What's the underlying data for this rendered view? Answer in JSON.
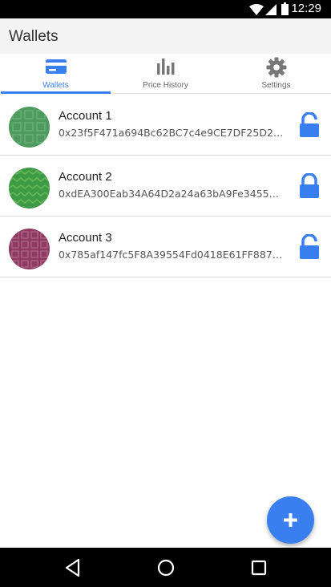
{
  "status_bar": {
    "time": "12:29",
    "icons": [
      "wifi-icon",
      "signal-icon",
      "battery-icon"
    ]
  },
  "app_bar": {
    "title": "Wallets"
  },
  "tabs": [
    {
      "label": "Wallets",
      "icon": "wallet-card-icon",
      "active": true
    },
    {
      "label": "Price History",
      "icon": "bar-chart-icon",
      "active": false
    },
    {
      "label": "Settings",
      "icon": "gear-icon",
      "active": false
    }
  ],
  "accounts": [
    {
      "name": "Account 1",
      "address": "0x23f5F471a694Bc62BC7c4e9CE7DF25D281...",
      "avatar_color": "#4e9a5f",
      "lock": "unlocked"
    },
    {
      "name": "Account 2",
      "address": "0xdEA300Eab34A64D2a24a63bA9Fe345583...",
      "avatar_color": "#3e9a45",
      "lock": "locked"
    },
    {
      "name": "Account 3",
      "address": "0x785af147fc5F8A39554Fd0418E61FF88799...",
      "avatar_color": "#8e3a62",
      "lock": "unlocked"
    }
  ],
  "fab": {
    "icon": "plus-icon"
  },
  "nav_bar": {
    "buttons": [
      "back-icon",
      "home-icon",
      "recents-icon"
    ]
  },
  "colors": {
    "accent": "#3a7ff0",
    "status_bar": "#000000",
    "app_bar": "#f4f4f4"
  }
}
